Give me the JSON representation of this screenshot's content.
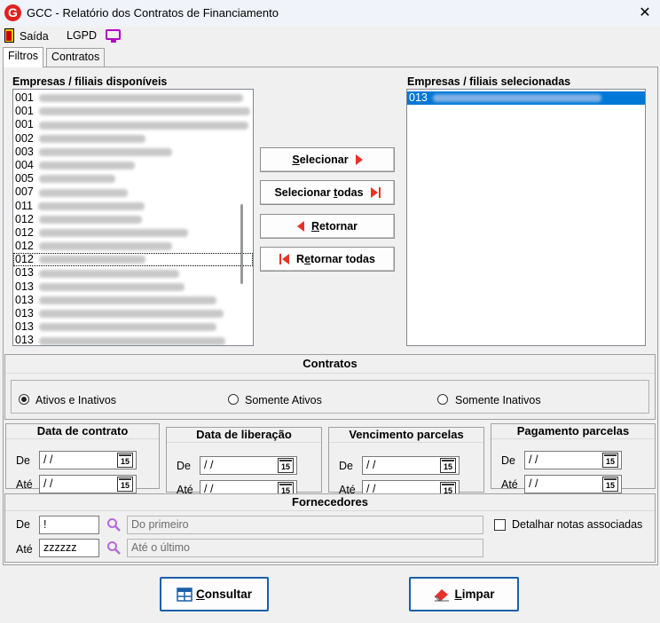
{
  "window": {
    "title": "GCC - Relatório dos Contratos de Financiamento",
    "app_letter": "G",
    "close": "✕"
  },
  "menu": {
    "exit": "Saída",
    "lgpd": "LGPD"
  },
  "tabs": [
    {
      "label": "Filtros"
    },
    {
      "label": "Contratos"
    }
  ],
  "available": {
    "label": "Empresas / filiais disponíveis",
    "items": [
      {
        "code": "001",
        "name_w": 230
      },
      {
        "code": "001",
        "name_w": 238
      },
      {
        "code": "001",
        "name_w": 236
      },
      {
        "code": "002",
        "name_w": 120
      },
      {
        "code": "003",
        "name_w": 150
      },
      {
        "code": "004",
        "name_w": 108
      },
      {
        "code": "005",
        "name_w": 86
      },
      {
        "code": "007",
        "name_w": 100
      },
      {
        "code": "011",
        "name_w": 120
      },
      {
        "code": "012",
        "name_w": 116
      },
      {
        "code": "012",
        "name_w": 168
      },
      {
        "code": "012",
        "name_w": 150
      },
      {
        "code": "012",
        "name_w": 120
      },
      {
        "code": "013",
        "name_w": 158
      },
      {
        "code": "013",
        "name_w": 164
      },
      {
        "code": "013",
        "name_w": 200
      },
      {
        "code": "013",
        "name_w": 208
      },
      {
        "code": "013",
        "name_w": 200
      },
      {
        "code": "013",
        "name_w": 210
      }
    ]
  },
  "selected": {
    "label": "Empresas / filiais selecionadas",
    "items": [
      {
        "code": "013",
        "name_w": 190
      }
    ]
  },
  "buttons": {
    "select_pre": "",
    "select_u": "S",
    "select_post": "elecionar",
    "select_all_pre": "Selecionar ",
    "select_all_u": "t",
    "select_all_post": "odas",
    "return_pre": "",
    "return_u": "R",
    "return_post": "etornar",
    "return_all_pre": "R",
    "return_all_u": "e",
    "return_all_post": "tornar todas"
  },
  "contracts": {
    "title": "Contratos",
    "options": [
      {
        "label": "Ativos e Inativos"
      },
      {
        "label": "Somente Ativos"
      },
      {
        "label": "Somente Inativos"
      }
    ],
    "selected_index": 0
  },
  "dates": {
    "de_label": "De",
    "ate_label": "Até",
    "empty_date": " / /",
    "calendar_label": "15",
    "groups": [
      {
        "title": "Data de contrato"
      },
      {
        "title": "Data de liberação"
      },
      {
        "title": "Vencimento parcelas"
      },
      {
        "title": "Pagamento parcelas"
      }
    ]
  },
  "suppliers": {
    "title": "Fornecedores",
    "de_label": "De",
    "ate_label": "Até",
    "de_value": "!",
    "ate_value": "zzzzzz",
    "de_placeholder": "Do primeiro",
    "ate_placeholder": "Até o último",
    "detail_label": "Detalhar notas associadas"
  },
  "footer": {
    "query_pre": "",
    "query_u": "C",
    "query_post": "onsultar",
    "clear_pre": "",
    "clear_u": "L",
    "clear_post": "impar"
  },
  "colors": {
    "accent": "#e8312a",
    "selection": "#0078d7",
    "lgpd_icon": "#b400c8"
  }
}
